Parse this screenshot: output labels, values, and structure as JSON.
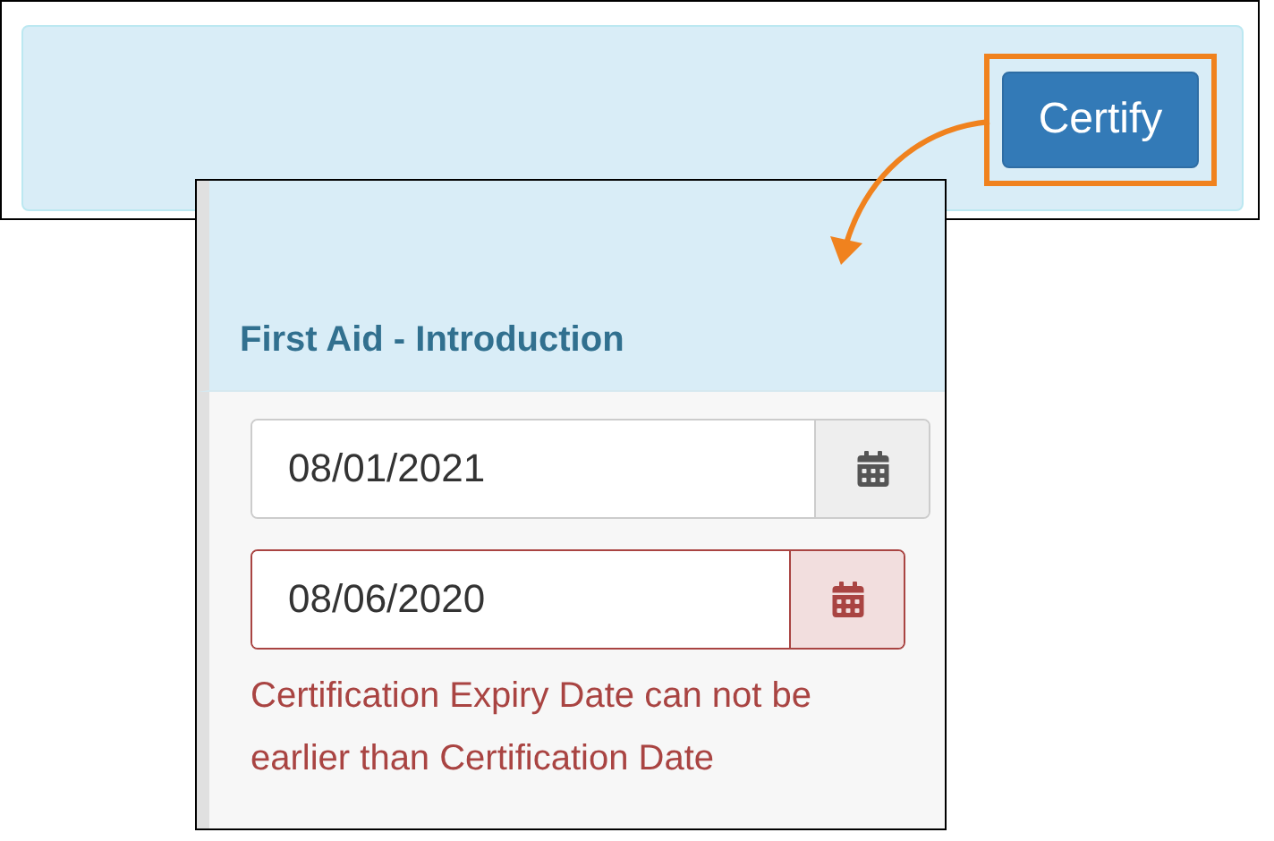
{
  "toolbar": {
    "button": "Certify",
    "highlighted": true
  },
  "panel": {
    "title": "First Aid - Introduction",
    "fields": [
      {
        "value": "08/01/2021",
        "invalid": false
      },
      {
        "value": "08/06/2020",
        "invalid": true
      }
    ],
    "error": "Certification Expiry Date can not be earlier than Certification Date"
  }
}
